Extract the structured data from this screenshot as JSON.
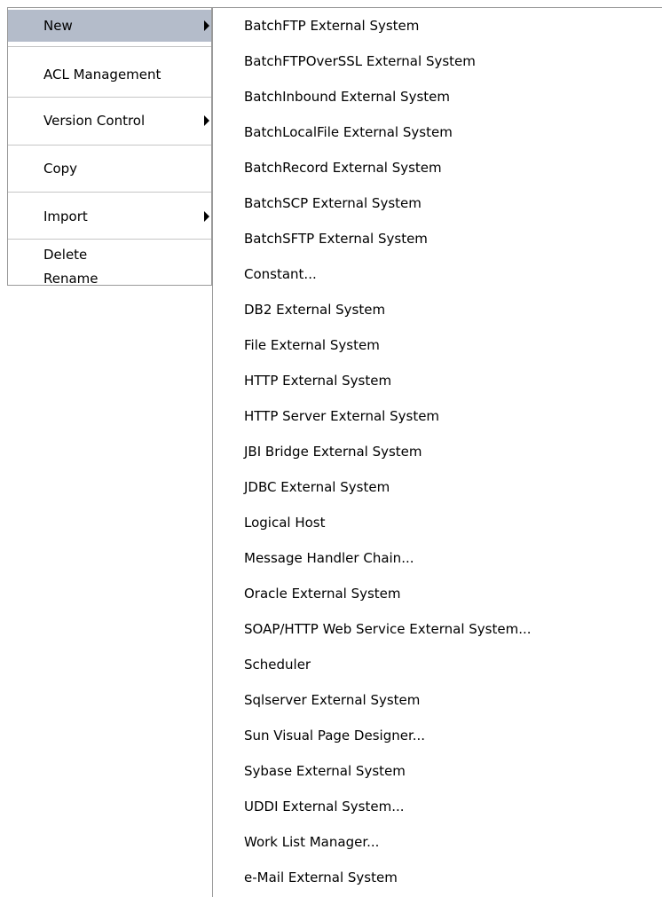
{
  "context_menu": {
    "items": [
      {
        "label": "New",
        "has_submenu": true,
        "selected": true
      },
      {
        "label": "ACL Management",
        "has_submenu": false
      },
      {
        "label": "Version Control",
        "has_submenu": true
      },
      {
        "label": "Copy",
        "has_submenu": false
      },
      {
        "label": "Import",
        "has_submenu": true
      },
      {
        "label": "Delete",
        "has_submenu": false
      },
      {
        "label": "Rename",
        "has_submenu": false
      }
    ]
  },
  "submenu": {
    "items": [
      {
        "label": "BatchFTP External System"
      },
      {
        "label": "BatchFTPOverSSL External System"
      },
      {
        "label": "BatchInbound External System"
      },
      {
        "label": "BatchLocalFile External System"
      },
      {
        "label": "BatchRecord External System"
      },
      {
        "label": "BatchSCP External System"
      },
      {
        "label": "BatchSFTP External System"
      },
      {
        "label": "Constant..."
      },
      {
        "label": "DB2 External System"
      },
      {
        "label": "File External System"
      },
      {
        "label": "HTTP External System"
      },
      {
        "label": "HTTP Server External System"
      },
      {
        "label": "JBI Bridge External System"
      },
      {
        "label": "JDBC External System"
      },
      {
        "label": "Logical Host"
      },
      {
        "label": "Message Handler Chain..."
      },
      {
        "label": "Oracle External System"
      },
      {
        "label": "SOAP/HTTP Web Service External System..."
      },
      {
        "label": "Scheduler"
      },
      {
        "label": "Sqlserver External System"
      },
      {
        "label": "Sun Visual Page Designer..."
      },
      {
        "label": "Sybase External System"
      },
      {
        "label": "UDDI External System..."
      },
      {
        "label": "Work List Manager..."
      },
      {
        "label": "e-Mail External System"
      }
    ]
  },
  "colors": {
    "selected_background": "#b4bcca",
    "menu_border": "#9a9a9a",
    "separator": "#c6c6c6"
  }
}
